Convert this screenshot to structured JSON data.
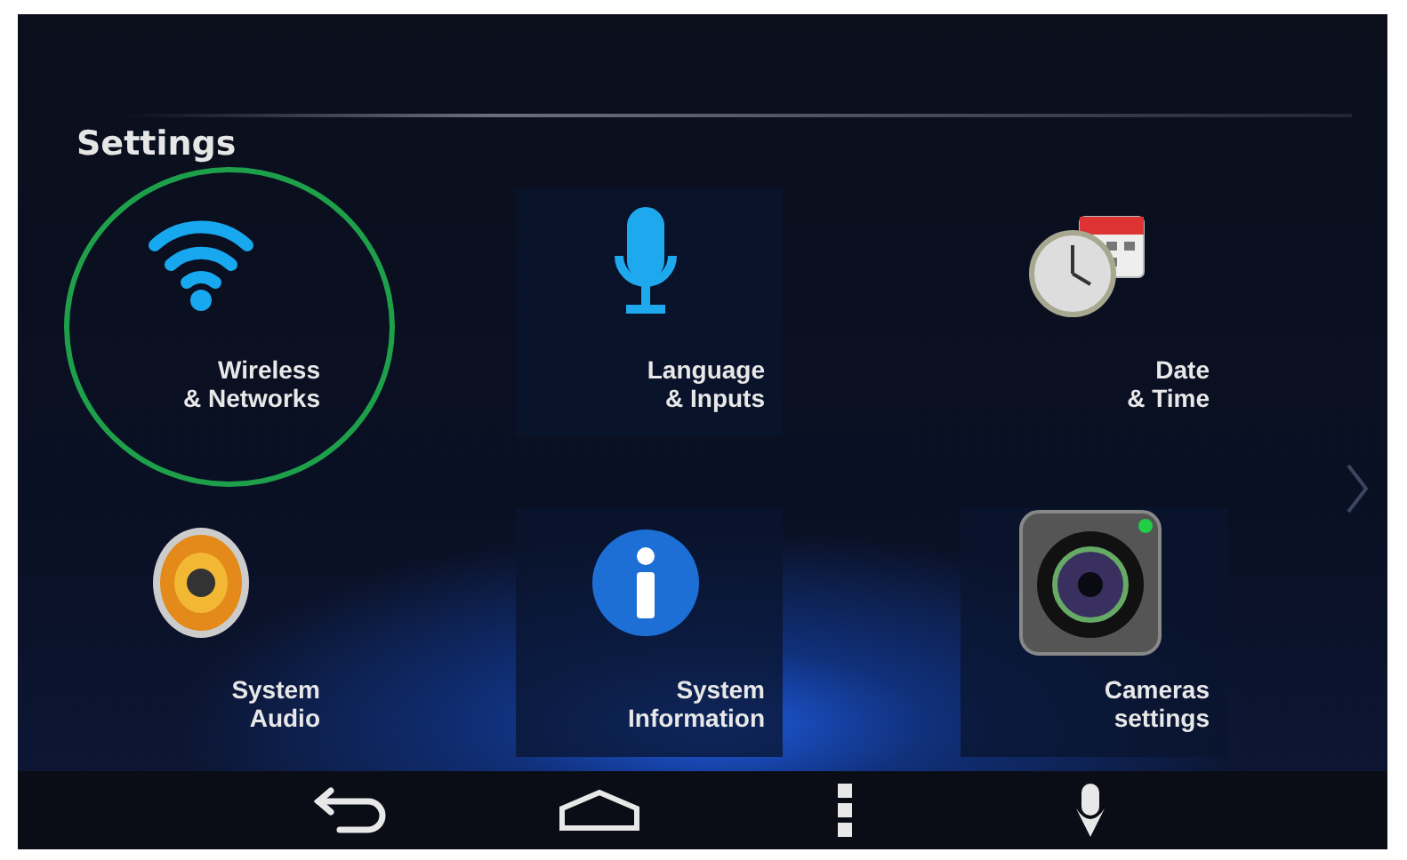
{
  "title": "Settings",
  "items": [
    {
      "kind": "wifi",
      "label": "Wireless\n& Networks",
      "highlighted": true,
      "focused": false
    },
    {
      "kind": "microphone",
      "label": "Language\n& Inputs",
      "highlighted": false,
      "focused": true
    },
    {
      "kind": "clock",
      "label": "Date\n& Time",
      "highlighted": false,
      "focused": false
    },
    {
      "kind": "speaker",
      "label": "System\nAudio",
      "highlighted": false,
      "focused": false
    },
    {
      "kind": "info",
      "label": "System\nInformation",
      "highlighted": false,
      "focused": true
    },
    {
      "kind": "camera",
      "label": "Cameras\nsettings",
      "highlighted": false,
      "focused": true
    }
  ]
}
